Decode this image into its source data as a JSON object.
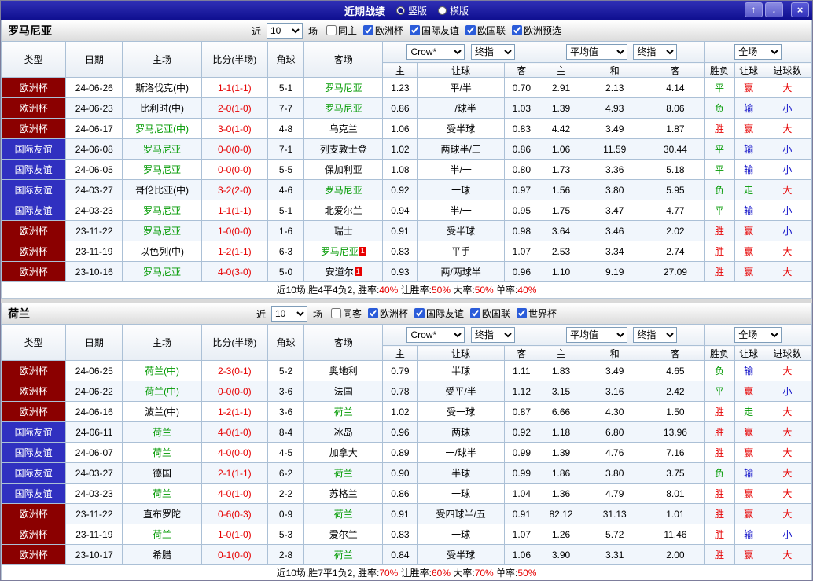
{
  "colors": {
    "red": "#e60000",
    "green": "#009900",
    "blue": "#0f0fc8",
    "black": "#000000",
    "green_team": "#009900",
    "league": {
      "欧洲杯": "#8b0000",
      "国际友谊": "#3030c0"
    }
  },
  "titlebar": {
    "title": "近期战绩",
    "radios": [
      {
        "label": "竖版",
        "selected": true
      },
      {
        "label": "横版",
        "selected": false
      }
    ],
    "up_icon": "↑",
    "down_icon": "↓",
    "close_icon": "×"
  },
  "controls": {
    "near_label": "近",
    "count_value": "10",
    "matches_label": "场"
  },
  "header_labels": {
    "type": "类型",
    "date": "日期",
    "home": "主场",
    "score": "比分(半场)",
    "corner": "角球",
    "away": "客场",
    "crow": "Crow*",
    "final1": "终指",
    "avg": "平均值",
    "final2": "终指",
    "full": "全场",
    "host": "主",
    "handicap": "让球",
    "guest": "客",
    "draw": "和",
    "result": "胜负",
    "goals": "进球数"
  },
  "sections": [
    {
      "team": "罗马尼亚",
      "filters": [
        {
          "label": "同主",
          "checked": false
        },
        {
          "label": "欧洲杯",
          "checked": true
        },
        {
          "label": "国际友谊",
          "checked": true
        },
        {
          "label": "欧国联",
          "checked": true
        },
        {
          "label": "欧洲预选",
          "checked": true
        }
      ],
      "rows": [
        {
          "league": "欧洲杯",
          "date": "24-06-26",
          "home": {
            "text": "斯洛伐克(中)"
          },
          "score": "1-1(1-1)",
          "corner": "5-1",
          "away": {
            "text": "罗马尼亚",
            "green": true
          },
          "asian_home": "1.23",
          "handicap": "平/半",
          "asian_away": "0.70",
          "euro_home": "2.91",
          "euro_draw": "2.13",
          "euro_away": "4.14",
          "result": [
            "平",
            "green"
          ],
          "handicap_result": [
            "赢",
            "red"
          ],
          "goals_result": [
            "大",
            "red"
          ]
        },
        {
          "league": "欧洲杯",
          "date": "24-06-23",
          "home": {
            "text": "比利时(中)"
          },
          "score": "2-0(1-0)",
          "corner": "7-7",
          "away": {
            "text": "罗马尼亚",
            "green": true
          },
          "asian_home": "0.86",
          "handicap": "一/球半",
          "asian_away": "1.03",
          "euro_home": "1.39",
          "euro_draw": "4.93",
          "euro_away": "8.06",
          "result": [
            "负",
            "green"
          ],
          "handicap_result": [
            "输",
            "blue"
          ],
          "goals_result": [
            "小",
            "blue"
          ]
        },
        {
          "league": "欧洲杯",
          "date": "24-06-17",
          "home": {
            "text": "罗马尼亚(中)",
            "green": true
          },
          "score": "3-0(1-0)",
          "corner": "4-8",
          "away": {
            "text": "乌克兰"
          },
          "asian_home": "1.06",
          "handicap": "受半球",
          "asian_away": "0.83",
          "euro_home": "4.42",
          "euro_draw": "3.49",
          "euro_away": "1.87",
          "result": [
            "胜",
            "red"
          ],
          "handicap_result": [
            "赢",
            "red"
          ],
          "goals_result": [
            "大",
            "red"
          ]
        },
        {
          "league": "国际友谊",
          "date": "24-06-08",
          "home": {
            "text": "罗马尼亚",
            "green": true
          },
          "score": "0-0(0-0)",
          "corner": "7-1",
          "away": {
            "text": "列支敦士登"
          },
          "asian_home": "1.02",
          "handicap": "两球半/三",
          "asian_away": "0.86",
          "euro_home": "1.06",
          "euro_draw": "11.59",
          "euro_away": "30.44",
          "result": [
            "平",
            "green"
          ],
          "handicap_result": [
            "输",
            "blue"
          ],
          "goals_result": [
            "小",
            "blue"
          ]
        },
        {
          "league": "国际友谊",
          "date": "24-06-05",
          "home": {
            "text": "罗马尼亚",
            "green": true
          },
          "score": "0-0(0-0)",
          "corner": "5-5",
          "away": {
            "text": "保加利亚"
          },
          "asian_home": "1.08",
          "handicap": "半/一",
          "asian_away": "0.80",
          "euro_home": "1.73",
          "euro_draw": "3.36",
          "euro_away": "5.18",
          "result": [
            "平",
            "green"
          ],
          "handicap_result": [
            "输",
            "blue"
          ],
          "goals_result": [
            "小",
            "blue"
          ]
        },
        {
          "league": "国际友谊",
          "date": "24-03-27",
          "home": {
            "text": "哥伦比亚(中)"
          },
          "score": "3-2(2-0)",
          "corner": "4-6",
          "away": {
            "text": "罗马尼亚",
            "green": true
          },
          "asian_home": "0.92",
          "handicap": "一球",
          "asian_away": "0.97",
          "euro_home": "1.56",
          "euro_draw": "3.80",
          "euro_away": "5.95",
          "result": [
            "负",
            "green"
          ],
          "handicap_result": [
            "走",
            "green"
          ],
          "goals_result": [
            "大",
            "red"
          ]
        },
        {
          "league": "国际友谊",
          "date": "24-03-23",
          "home": {
            "text": "罗马尼亚",
            "green": true
          },
          "score": "1-1(1-1)",
          "corner": "5-1",
          "away": {
            "text": "北爱尔兰"
          },
          "asian_home": "0.94",
          "handicap": "半/一",
          "asian_away": "0.95",
          "euro_home": "1.75",
          "euro_draw": "3.47",
          "euro_away": "4.77",
          "result": [
            "平",
            "green"
          ],
          "handicap_result": [
            "输",
            "blue"
          ],
          "goals_result": [
            "小",
            "blue"
          ]
        },
        {
          "league": "欧洲杯",
          "date": "23-11-22",
          "home": {
            "text": "罗马尼亚",
            "green": true
          },
          "score": "1-0(0-0)",
          "corner": "1-6",
          "away": {
            "text": "瑞士"
          },
          "asian_home": "0.91",
          "handicap": "受半球",
          "asian_away": "0.98",
          "euro_home": "3.64",
          "euro_draw": "3.46",
          "euro_away": "2.02",
          "result": [
            "胜",
            "red"
          ],
          "handicap_result": [
            "赢",
            "red"
          ],
          "goals_result": [
            "小",
            "blue"
          ]
        },
        {
          "league": "欧洲杯",
          "date": "23-11-19",
          "home": {
            "text": "以色列(中)"
          },
          "score": "1-2(1-1)",
          "corner": "6-3",
          "away": {
            "text": "罗马尼亚",
            "green": true,
            "badge": "1"
          },
          "asian_home": "0.83",
          "handicap": "平手",
          "asian_away": "1.07",
          "euro_home": "2.53",
          "euro_draw": "3.34",
          "euro_away": "2.74",
          "result": [
            "胜",
            "red"
          ],
          "handicap_result": [
            "赢",
            "red"
          ],
          "goals_result": [
            "大",
            "red"
          ]
        },
        {
          "league": "欧洲杯",
          "date": "23-10-16",
          "home": {
            "text": "罗马尼亚",
            "green": true
          },
          "score": "4-0(3-0)",
          "corner": "5-0",
          "away": {
            "text": "安道尔",
            "badge": "1"
          },
          "asian_home": "0.93",
          "handicap": "两/两球半",
          "asian_away": "0.96",
          "euro_home": "1.10",
          "euro_draw": "9.19",
          "euro_away": "27.09",
          "result": [
            "胜",
            "red"
          ],
          "handicap_result": [
            "赢",
            "red"
          ],
          "goals_result": [
            "大",
            "red"
          ]
        }
      ],
      "summary": [
        {
          "t": "近10场,胜4平4负2, ",
          "c": "black"
        },
        {
          "t": "胜率:",
          "c": "black"
        },
        {
          "t": "40%",
          "c": "red"
        },
        {
          "t": " 让胜率:",
          "c": "black"
        },
        {
          "t": "50%",
          "c": "red"
        },
        {
          "t": " 大率:",
          "c": "black"
        },
        {
          "t": "50%",
          "c": "red"
        },
        {
          "t": " 单率:",
          "c": "black"
        },
        {
          "t": "40%",
          "c": "red"
        }
      ]
    },
    {
      "team": "荷兰",
      "filters": [
        {
          "label": "同客",
          "checked": false
        },
        {
          "label": "欧洲杯",
          "checked": true
        },
        {
          "label": "国际友谊",
          "checked": true
        },
        {
          "label": "欧国联",
          "checked": true
        },
        {
          "label": "世界杯",
          "checked": true
        }
      ],
      "rows": [
        {
          "league": "欧洲杯",
          "date": "24-06-25",
          "home": {
            "text": "荷兰(中)",
            "green": true
          },
          "score": "2-3(0-1)",
          "corner": "5-2",
          "away": {
            "text": "奥地利"
          },
          "asian_home": "0.79",
          "handicap": "半球",
          "asian_away": "1.11",
          "euro_home": "1.83",
          "euro_draw": "3.49",
          "euro_away": "4.65",
          "result": [
            "负",
            "green"
          ],
          "handicap_result": [
            "输",
            "blue"
          ],
          "goals_result": [
            "大",
            "red"
          ]
        },
        {
          "league": "欧洲杯",
          "date": "24-06-22",
          "home": {
            "text": "荷兰(中)",
            "green": true
          },
          "score": "0-0(0-0)",
          "corner": "3-6",
          "away": {
            "text": "法国"
          },
          "asian_home": "0.78",
          "handicap": "受平/半",
          "asian_away": "1.12",
          "euro_home": "3.15",
          "euro_draw": "3.16",
          "euro_away": "2.42",
          "result": [
            "平",
            "green"
          ],
          "handicap_result": [
            "赢",
            "red"
          ],
          "goals_result": [
            "小",
            "blue"
          ]
        },
        {
          "league": "欧洲杯",
          "date": "24-06-16",
          "home": {
            "text": "波兰(中)"
          },
          "score": "1-2(1-1)",
          "corner": "3-6",
          "away": {
            "text": "荷兰",
            "green": true
          },
          "asian_home": "1.02",
          "handicap": "受一球",
          "asian_away": "0.87",
          "euro_home": "6.66",
          "euro_draw": "4.30",
          "euro_away": "1.50",
          "result": [
            "胜",
            "red"
          ],
          "handicap_result": [
            "走",
            "green"
          ],
          "goals_result": [
            "大",
            "red"
          ]
        },
        {
          "league": "国际友谊",
          "date": "24-06-11",
          "home": {
            "text": "荷兰",
            "green": true
          },
          "score": "4-0(1-0)",
          "corner": "8-4",
          "away": {
            "text": "冰岛"
          },
          "asian_home": "0.96",
          "handicap": "两球",
          "asian_away": "0.92",
          "euro_home": "1.18",
          "euro_draw": "6.80",
          "euro_away": "13.96",
          "result": [
            "胜",
            "red"
          ],
          "handicap_result": [
            "赢",
            "red"
          ],
          "goals_result": [
            "大",
            "red"
          ]
        },
        {
          "league": "国际友谊",
          "date": "24-06-07",
          "home": {
            "text": "荷兰",
            "green": true
          },
          "score": "4-0(0-0)",
          "corner": "4-5",
          "away": {
            "text": "加拿大"
          },
          "asian_home": "0.89",
          "handicap": "一/球半",
          "asian_away": "0.99",
          "euro_home": "1.39",
          "euro_draw": "4.76",
          "euro_away": "7.16",
          "result": [
            "胜",
            "red"
          ],
          "handicap_result": [
            "赢",
            "red"
          ],
          "goals_result": [
            "大",
            "red"
          ]
        },
        {
          "league": "国际友谊",
          "date": "24-03-27",
          "home": {
            "text": "德国"
          },
          "score": "2-1(1-1)",
          "corner": "6-2",
          "away": {
            "text": "荷兰",
            "green": true
          },
          "asian_home": "0.90",
          "handicap": "半球",
          "asian_away": "0.99",
          "euro_home": "1.86",
          "euro_draw": "3.80",
          "euro_away": "3.75",
          "result": [
            "负",
            "green"
          ],
          "handicap_result": [
            "输",
            "blue"
          ],
          "goals_result": [
            "大",
            "red"
          ]
        },
        {
          "league": "国际友谊",
          "date": "24-03-23",
          "home": {
            "text": "荷兰",
            "green": true
          },
          "score": "4-0(1-0)",
          "corner": "2-2",
          "away": {
            "text": "苏格兰"
          },
          "asian_home": "0.86",
          "handicap": "一球",
          "asian_away": "1.04",
          "euro_home": "1.36",
          "euro_draw": "4.79",
          "euro_away": "8.01",
          "result": [
            "胜",
            "red"
          ],
          "handicap_result": [
            "赢",
            "red"
          ],
          "goals_result": [
            "大",
            "red"
          ]
        },
        {
          "league": "欧洲杯",
          "date": "23-11-22",
          "home": {
            "text": "直布罗陀"
          },
          "score": "0-6(0-3)",
          "corner": "0-9",
          "away": {
            "text": "荷兰",
            "green": true
          },
          "asian_home": "0.91",
          "handicap": "受四球半/五",
          "asian_away": "0.91",
          "euro_home": "82.12",
          "euro_draw": "31.13",
          "euro_away": "1.01",
          "result": [
            "胜",
            "red"
          ],
          "handicap_result": [
            "赢",
            "red"
          ],
          "goals_result": [
            "大",
            "red"
          ]
        },
        {
          "league": "欧洲杯",
          "date": "23-11-19",
          "home": {
            "text": "荷兰",
            "green": true
          },
          "score": "1-0(1-0)",
          "corner": "5-3",
          "away": {
            "text": "爱尔兰"
          },
          "asian_home": "0.83",
          "handicap": "一球",
          "asian_away": "1.07",
          "euro_home": "1.26",
          "euro_draw": "5.72",
          "euro_away": "11.46",
          "result": [
            "胜",
            "red"
          ],
          "handicap_result": [
            "输",
            "blue"
          ],
          "goals_result": [
            "小",
            "blue"
          ]
        },
        {
          "league": "欧洲杯",
          "date": "23-10-17",
          "home": {
            "text": "希腊"
          },
          "score": "0-1(0-0)",
          "corner": "2-8",
          "away": {
            "text": "荷兰",
            "green": true
          },
          "asian_home": "0.84",
          "handicap": "受半球",
          "asian_away": "1.06",
          "euro_home": "3.90",
          "euro_draw": "3.31",
          "euro_away": "2.00",
          "result": [
            "胜",
            "red"
          ],
          "handicap_result": [
            "赢",
            "red"
          ],
          "goals_result": [
            "大",
            "red"
          ]
        }
      ],
      "summary": [
        {
          "t": "近10场,胜7平1负2, ",
          "c": "black"
        },
        {
          "t": "胜率:",
          "c": "black"
        },
        {
          "t": "70%",
          "c": "red"
        },
        {
          "t": " 让胜率:",
          "c": "black"
        },
        {
          "t": "60%",
          "c": "red"
        },
        {
          "t": " 大率:",
          "c": "black"
        },
        {
          "t": "70%",
          "c": "red"
        },
        {
          "t": " 单率:",
          "c": "black"
        },
        {
          "t": "50%",
          "c": "red"
        }
      ]
    }
  ]
}
